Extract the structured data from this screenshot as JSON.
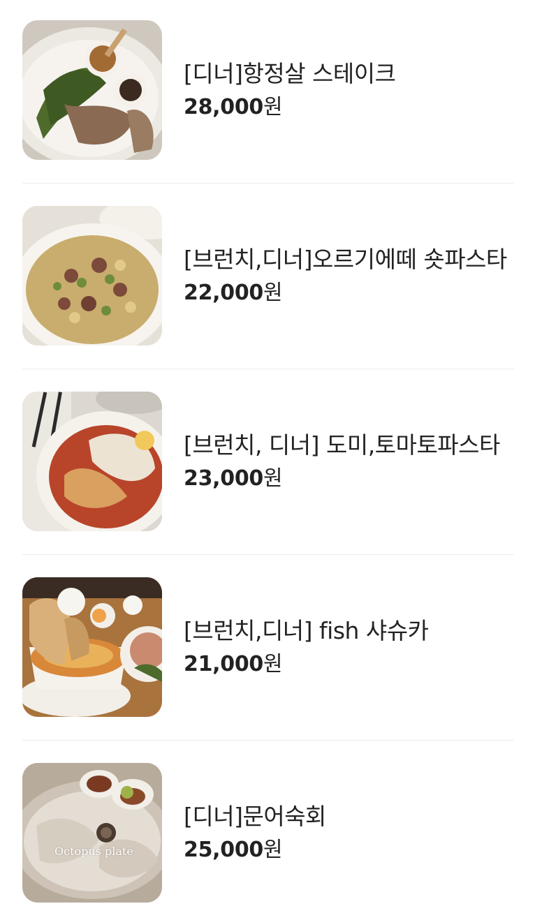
{
  "menu": {
    "items": [
      {
        "name": "[디너]항정살 스테이크",
        "price": "28,000",
        "unit": "원",
        "photo": "steak-plate-photo"
      },
      {
        "name": "[브런치,디너]오르기에떼 숏파스타",
        "price": "22,000",
        "unit": "원",
        "photo": "orecchiette-pasta-photo"
      },
      {
        "name": "[브런치, 디너] 도미,토마토파스타",
        "price": "23,000",
        "unit": "원",
        "photo": "seabream-tomato-pasta-photo"
      },
      {
        "name": "[브런치,디너] fish 샤슈카",
        "price": "21,000",
        "unit": "원",
        "photo": "fish-shakshuka-photo"
      },
      {
        "name": "[디너]문어숙회",
        "price": "25,000",
        "unit": "원",
        "photo": "octopus-plate-photo",
        "photo_caption": "Octopus plate"
      }
    ]
  },
  "colors": {
    "text": "#222222",
    "divider": "#ececec",
    "background": "#ffffff"
  }
}
